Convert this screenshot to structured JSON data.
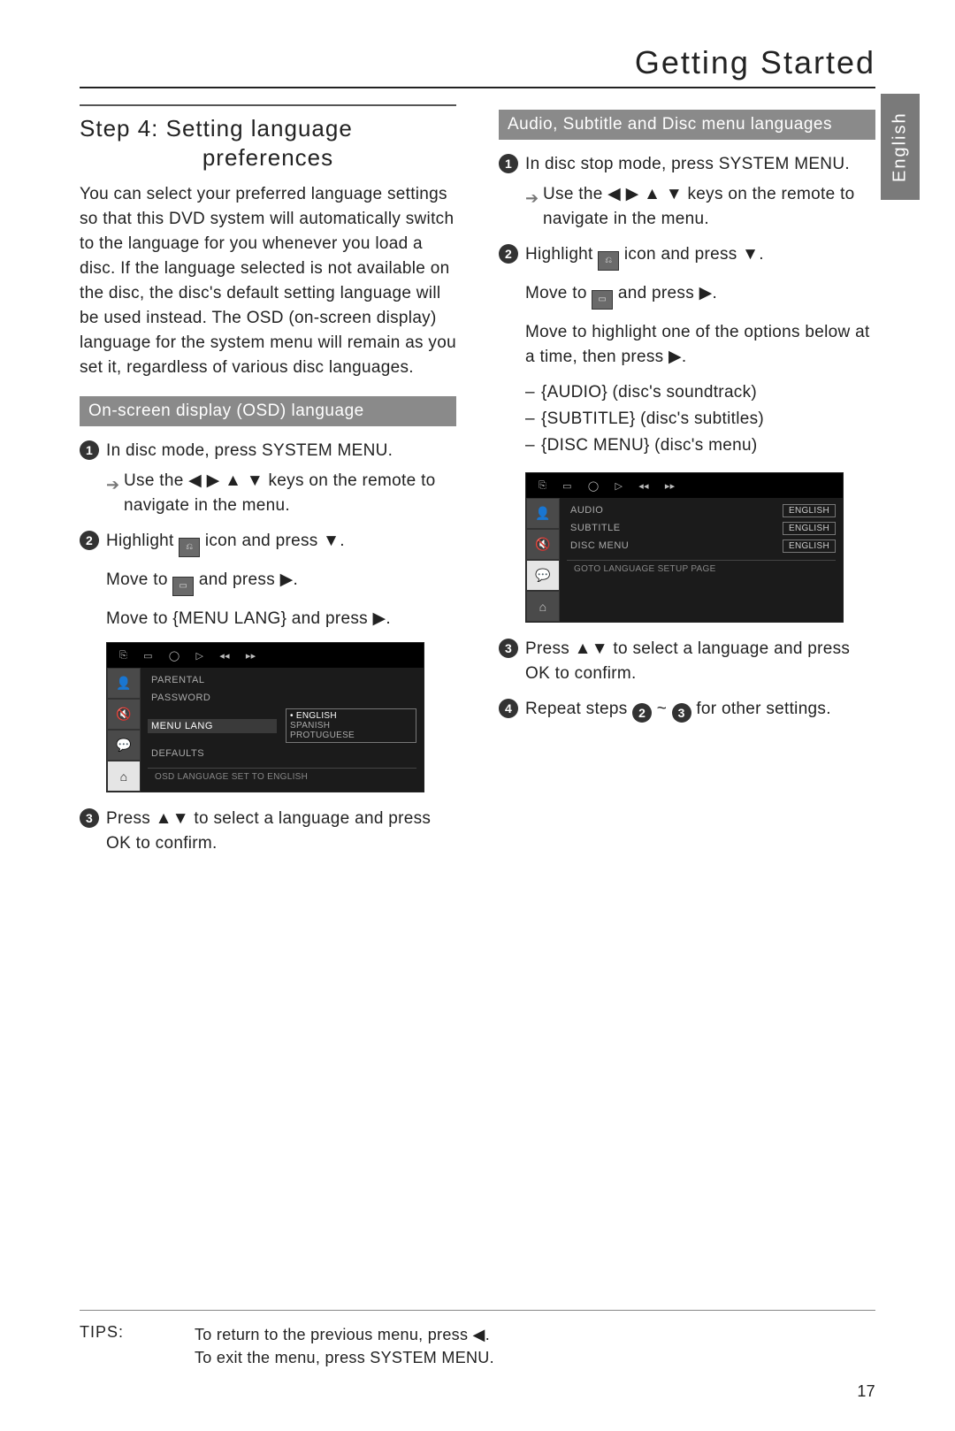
{
  "header": {
    "title": "Getting Started"
  },
  "lang_tab": "English",
  "page_number": "17",
  "left": {
    "step_title_a": "Step 4:  Setting language",
    "step_title_b": "preferences",
    "intro": "You can select your preferred language settings so that this DVD system will automatically switch to the language for you whenever you load a disc.  If the language selected is not available on the disc, the disc's default setting language will be used instead.  The OSD (on-screen display) language for the system menu will remain as you set it, regardless of various disc languages.",
    "section1": "On-screen display (OSD) language",
    "s1_1": "In disc mode, press SYSTEM MENU.",
    "s1_1_sub": "Use the ◀ ▶ ▲ ▼ keys on the remote to navigate in the menu.",
    "s1_2a": "Highlight ",
    "s1_2b": " icon and press ▼.",
    "s1_2c": "Move to ",
    "s1_2d": " and press ▶.",
    "s1_2e": "Move to {MENU LANG} and press ▶.",
    "s1_3": "Press ▲▼ to select a language and press OK to confirm.",
    "osd1": {
      "rows": [
        "PARENTAL",
        "PASSWORD",
        "MENU LANG",
        "DEFAULTS"
      ],
      "selected": "MENU LANG",
      "drop": [
        "ENGLISH",
        "SPANISH",
        "PROTUGUESE"
      ],
      "foot": "OSD LANGUAGE SET TO ENGLISH"
    }
  },
  "right": {
    "section2": "Audio, Subtitle and Disc menu languages",
    "r1": "In disc stop mode, press SYSTEM MENU.",
    "r1_sub": "Use the ◀ ▶ ▲ ▼ keys on the remote to navigate in the menu.",
    "r2a": "Highlight ",
    "r2b": " icon and press ▼.",
    "r2c": "Move to ",
    "r2d": " and press ▶.",
    "r2e": "Move to highlight one of the options below at a time, then press ▶.",
    "opts": [
      "{AUDIO} (disc's soundtrack)",
      "{SUBTITLE} (disc's subtitles)",
      "{DISC MENU} (disc's menu)"
    ],
    "r3": "Press ▲▼ to select a language and press OK to confirm.",
    "r4a": "Repeat steps ",
    "r4b": " ~ ",
    "r4c": " for other settings.",
    "osd2": {
      "rows": [
        "AUDIO",
        "SUBTITLE",
        "DISC MENU"
      ],
      "vals": [
        "ENGLISH",
        "ENGLISH",
        "ENGLISH"
      ],
      "foot": "GOTO LANGUAGE SETUP PAGE"
    }
  },
  "tips": {
    "label": "TIPS:",
    "line1": "To return to the previous menu, press ◀.",
    "line2": "To exit the menu, press SYSTEM MENU."
  }
}
